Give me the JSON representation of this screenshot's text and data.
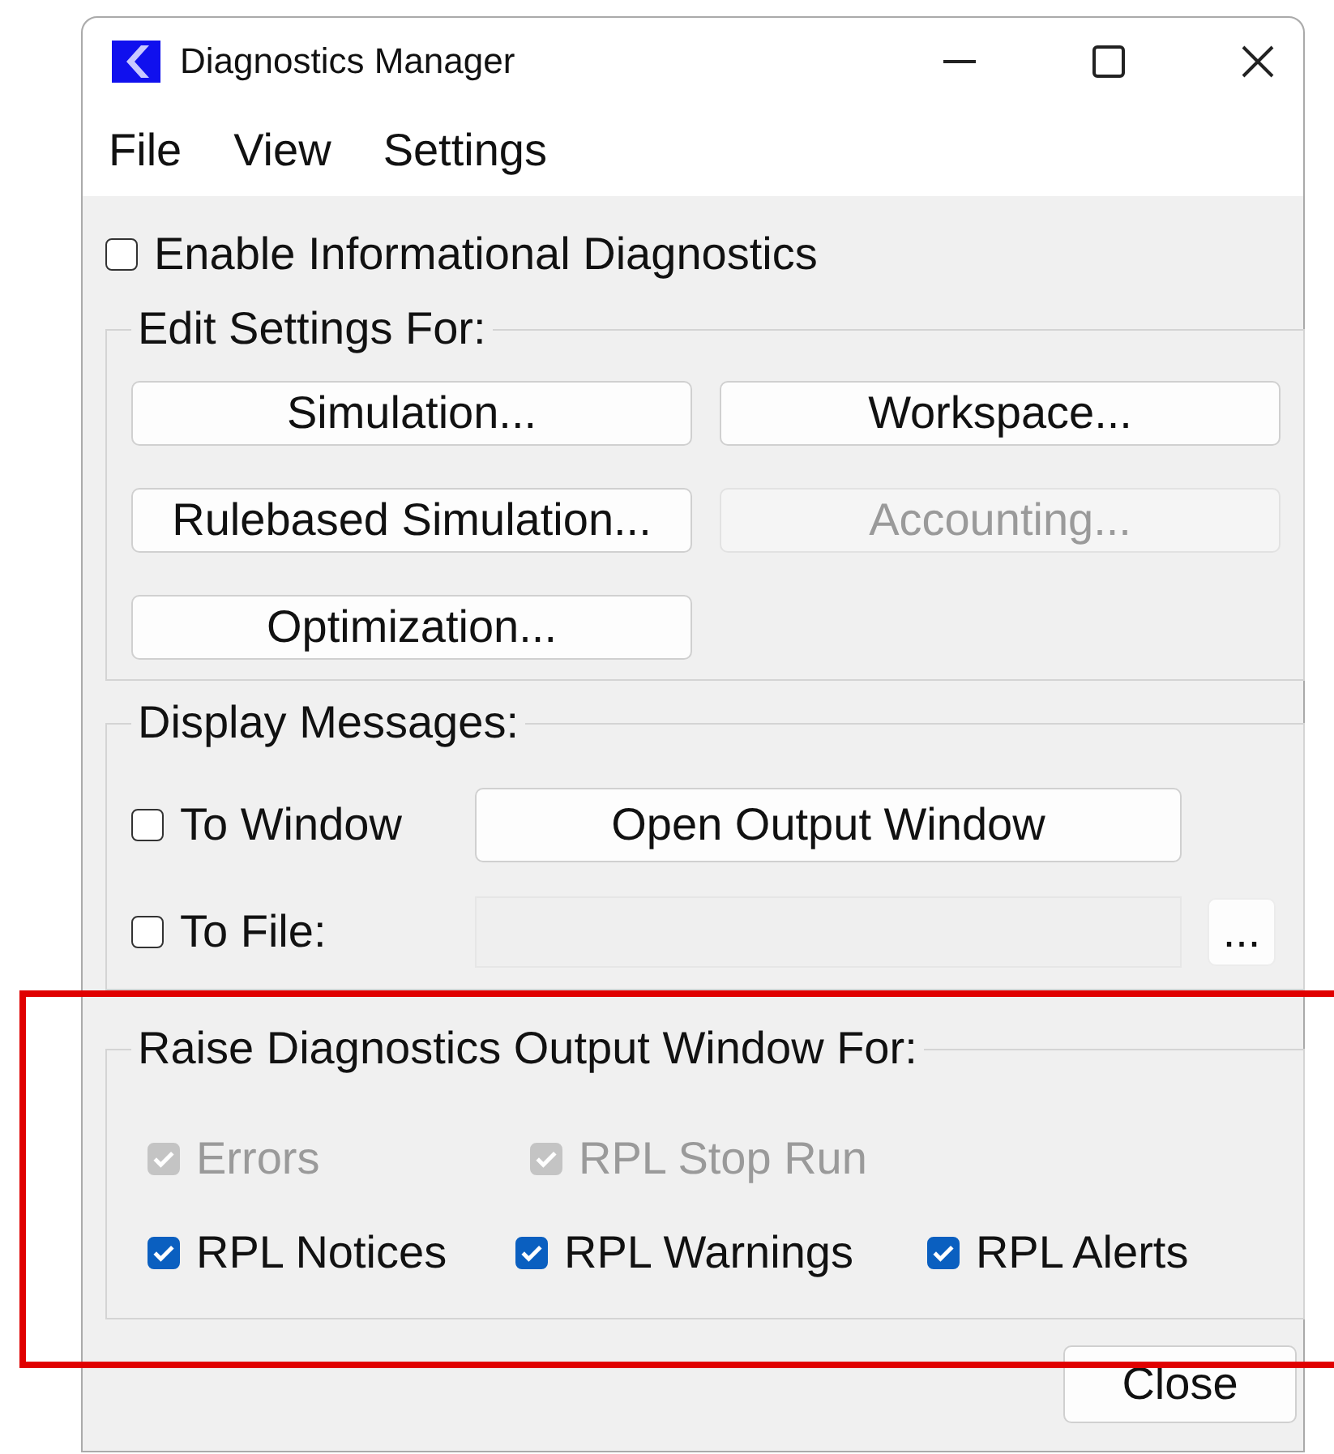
{
  "window": {
    "title": "Diagnostics Manager"
  },
  "menu": [
    "File",
    "View",
    "Settings"
  ],
  "enable_informational": {
    "label": "Enable Informational Diagnostics",
    "checked": false
  },
  "edit_settings": {
    "title": "Edit Settings For:",
    "buttons": [
      {
        "label": "Simulation...",
        "disabled": false
      },
      {
        "label": "Workspace...",
        "disabled": false
      },
      {
        "label": "Rulebased Simulation...",
        "disabled": false
      },
      {
        "label": "Accounting...",
        "disabled": true
      },
      {
        "label": "Optimization...",
        "disabled": false
      }
    ]
  },
  "display_messages": {
    "title": "Display Messages:",
    "to_window": {
      "label": "To Window",
      "checked": false
    },
    "open_button": "Open Output Window",
    "to_file": {
      "label": "To File:",
      "checked": false
    },
    "browse_button": "..."
  },
  "raise_for": {
    "title": "Raise Diagnostics Output Window For:",
    "highlighted": true,
    "rows": [
      [
        {
          "label": "Errors",
          "checked": true,
          "disabled": true
        },
        {
          "label": "RPL Stop Run",
          "checked": true,
          "disabled": true
        }
      ],
      [
        {
          "label": "RPL Notices",
          "checked": true,
          "disabled": false
        },
        {
          "label": "RPL Warnings",
          "checked": true,
          "disabled": false
        },
        {
          "label": "RPL Alerts",
          "checked": true,
          "disabled": false
        }
      ]
    ]
  },
  "close_button": "Close"
}
